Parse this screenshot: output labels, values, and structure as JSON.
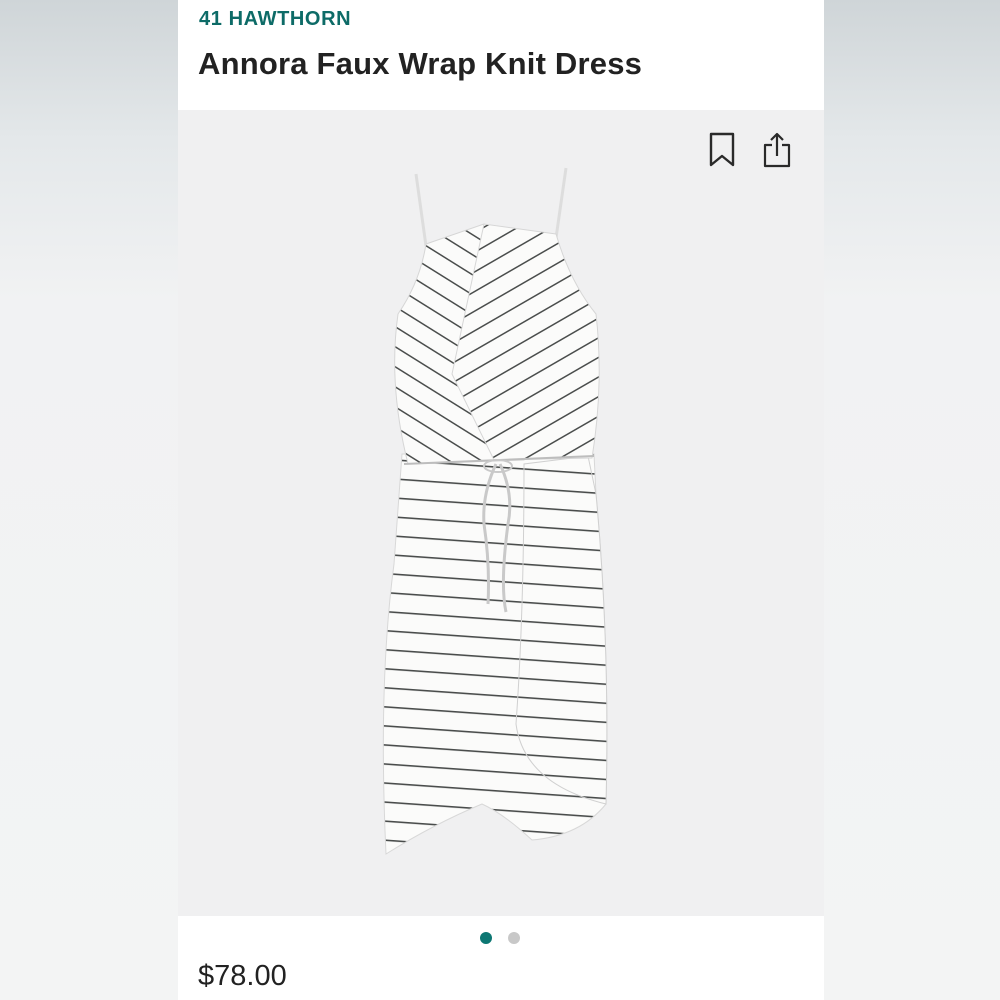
{
  "product": {
    "brand": "41 HAWTHORN",
    "name": "Annora Faux Wrap Knit Dress",
    "price": "$78.00"
  },
  "gallery": {
    "image_count": 2,
    "active_index": 0,
    "image_description_icon": "striped-wrap-dress-image"
  },
  "actions": {
    "bookmark_icon": "bookmark-icon",
    "share_icon": "share-icon"
  },
  "colors": {
    "brand": "#0d6b67",
    "dot_active": "#0d7773",
    "dot_inactive": "#c8c8c8",
    "text": "#222222"
  }
}
